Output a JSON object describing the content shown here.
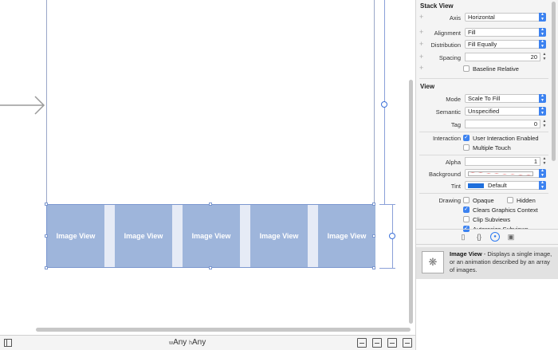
{
  "canvas": {
    "image_views": [
      "Image View",
      "Image View",
      "Image View",
      "Image View",
      "Image View"
    ]
  },
  "bottom_bar": {
    "w_prefix": "w",
    "w_value": "Any",
    "h_prefix": "h",
    "h_value": "Any"
  },
  "inspector": {
    "stack_view": {
      "title": "Stack View",
      "axis_label": "Axis",
      "axis_value": "Horizontal",
      "alignment_label": "Alignment",
      "alignment_value": "Fill",
      "distribution_label": "Distribution",
      "distribution_value": "Fill Equally",
      "spacing_label": "Spacing",
      "spacing_value": "20",
      "baseline_label": "Baseline Relative",
      "baseline_checked": false
    },
    "view": {
      "title": "View",
      "mode_label": "Mode",
      "mode_value": "Scale To Fill",
      "semantic_label": "Semantic",
      "semantic_value": "Unspecified",
      "tag_label": "Tag",
      "tag_value": "0",
      "interaction_label": "Interaction",
      "user_interaction_label": "User Interaction Enabled",
      "user_interaction_checked": true,
      "multiple_touch_label": "Multiple Touch",
      "multiple_touch_checked": false,
      "alpha_label": "Alpha",
      "alpha_value": "1",
      "background_label": "Background",
      "tint_label": "Tint",
      "tint_value": "Default",
      "tint_color": "#1f6fdc",
      "drawing_label": "Drawing",
      "opaque_label": "Opaque",
      "hidden_label": "Hidden",
      "clears_label": "Clears Graphics Context",
      "clip_label": "Clip Subviews",
      "autoresize_label": "Autoresize Subviews"
    },
    "library": {
      "item_title": "Image View",
      "item_description": " - Displays a single image, or an animation described by an array of images."
    }
  },
  "colors": {
    "accent": "#3c82f0",
    "selection_fill": "#9eb5db"
  },
  "icons": [
    "entry-arrow-icon",
    "document-outline-icon",
    "file-inspector-icon",
    "code-braces-icon",
    "object-library-icon",
    "media-library-icon",
    "image-view-thumbnail-icon"
  ]
}
